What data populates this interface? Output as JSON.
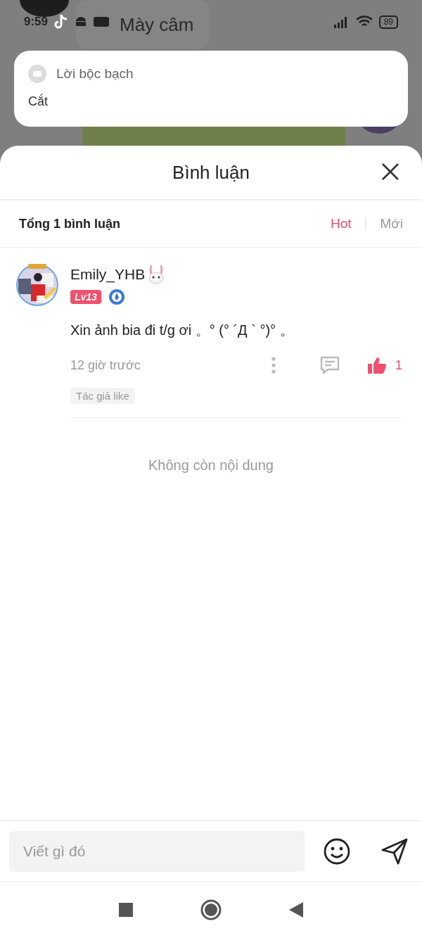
{
  "status_bar": {
    "time": "9:59",
    "battery": "89"
  },
  "background_chat": {
    "title": "Mày câm"
  },
  "notification": {
    "app": "Lời bộc bạch",
    "text": "Cắt"
  },
  "sheet": {
    "title": "Bình luận"
  },
  "comments_header": {
    "total": "Tổng 1 bình luận",
    "sort_tabs": [
      {
        "label": "Hot",
        "selected": true
      },
      {
        "label": "Mới",
        "selected": false
      }
    ]
  },
  "comments": [
    {
      "author": "Emily_YHB",
      "level": "Lv13",
      "text": "Xin ảnh bia đi t/g ơi 。° (° ´Д ` °)° 。",
      "time": "12 giờ trước",
      "likes": "1",
      "liked": true,
      "tag": "Tác giả like"
    }
  ],
  "end_text": "Không còn nội dung",
  "composer": {
    "placeholder": "Viết gì đó"
  }
}
